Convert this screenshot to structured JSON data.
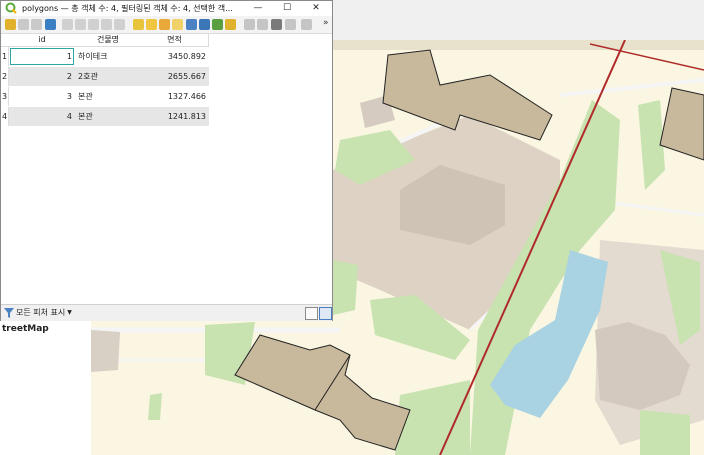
{
  "window": {
    "title": "polygons — 총 객체 수: 4, 필터링된 객체 수: 4, 선택한 객..."
  },
  "window_controls": {
    "minimize": "—",
    "maximize": "☐",
    "close": "✕"
  },
  "toolbar": {
    "overflow": "»"
  },
  "table": {
    "columns": [
      "id",
      "건물명",
      "면적"
    ],
    "rows": [
      {
        "row": "1",
        "id": "1",
        "name": "하이테크",
        "area": "3450.892"
      },
      {
        "row": "2",
        "id": "2",
        "name": "2호관",
        "area": "2655.667"
      },
      {
        "row": "3",
        "id": "3",
        "name": "본관",
        "area": "1327.466"
      },
      {
        "row": "4",
        "id": "4",
        "name": "본관",
        "area": "1241.813"
      }
    ]
  },
  "bottombar": {
    "filter_label": "모든 피처 표시"
  },
  "layers_panel": {
    "layer_name": "treetMap"
  },
  "colors": {
    "map_background": "#faf6e2",
    "building": "#c8b99c",
    "park": "#c8e2b0",
    "water": "#a9d3e2",
    "rail": "#b02a2a"
  }
}
